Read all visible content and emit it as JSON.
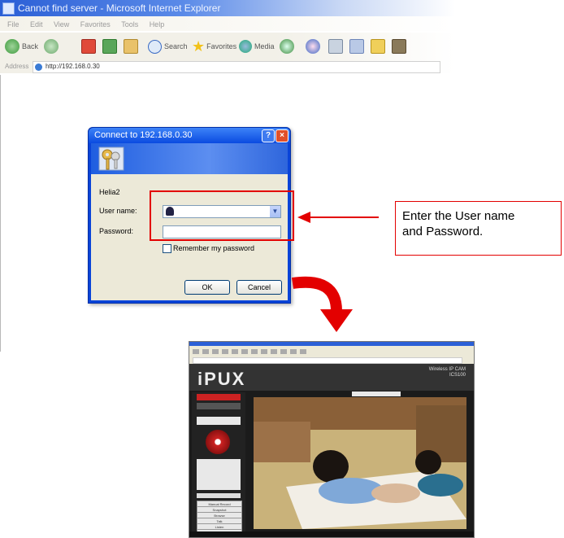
{
  "browser": {
    "title": "Cannot find server - Microsoft Internet Explorer",
    "menu": [
      "File",
      "Edit",
      "View",
      "Favorites",
      "Tools",
      "Help"
    ],
    "toolbar": {
      "back_label": "Back",
      "search_label": "Search",
      "favorites_label": "Favorites",
      "media_label": "Media"
    },
    "address": {
      "label": "Address",
      "url": "http://192.168.0.30"
    }
  },
  "dialog": {
    "title": "Connect to 192.168.0.30",
    "help_glyph": "?",
    "close_glyph": "×",
    "message": "Helia2",
    "username_label": "User name:",
    "password_label": "Password:",
    "remember_label": "Remember my password",
    "ok_label": "OK",
    "cancel_label": "Cancel"
  },
  "callout": {
    "line1": "Enter the User name",
    "line2": "and Password."
  },
  "camera_page": {
    "logo": "iPUX",
    "model_line1": "Wireless IP CAM",
    "model_line2": "ICS100",
    "side_buttons": [
      "Manual Record",
      "Snapshot",
      "Browse",
      "Talk",
      "Listen",
      "Trigger Out"
    ]
  },
  "colors": {
    "highlight_red": "#e30000",
    "xp_blue": "#0a44d8"
  }
}
